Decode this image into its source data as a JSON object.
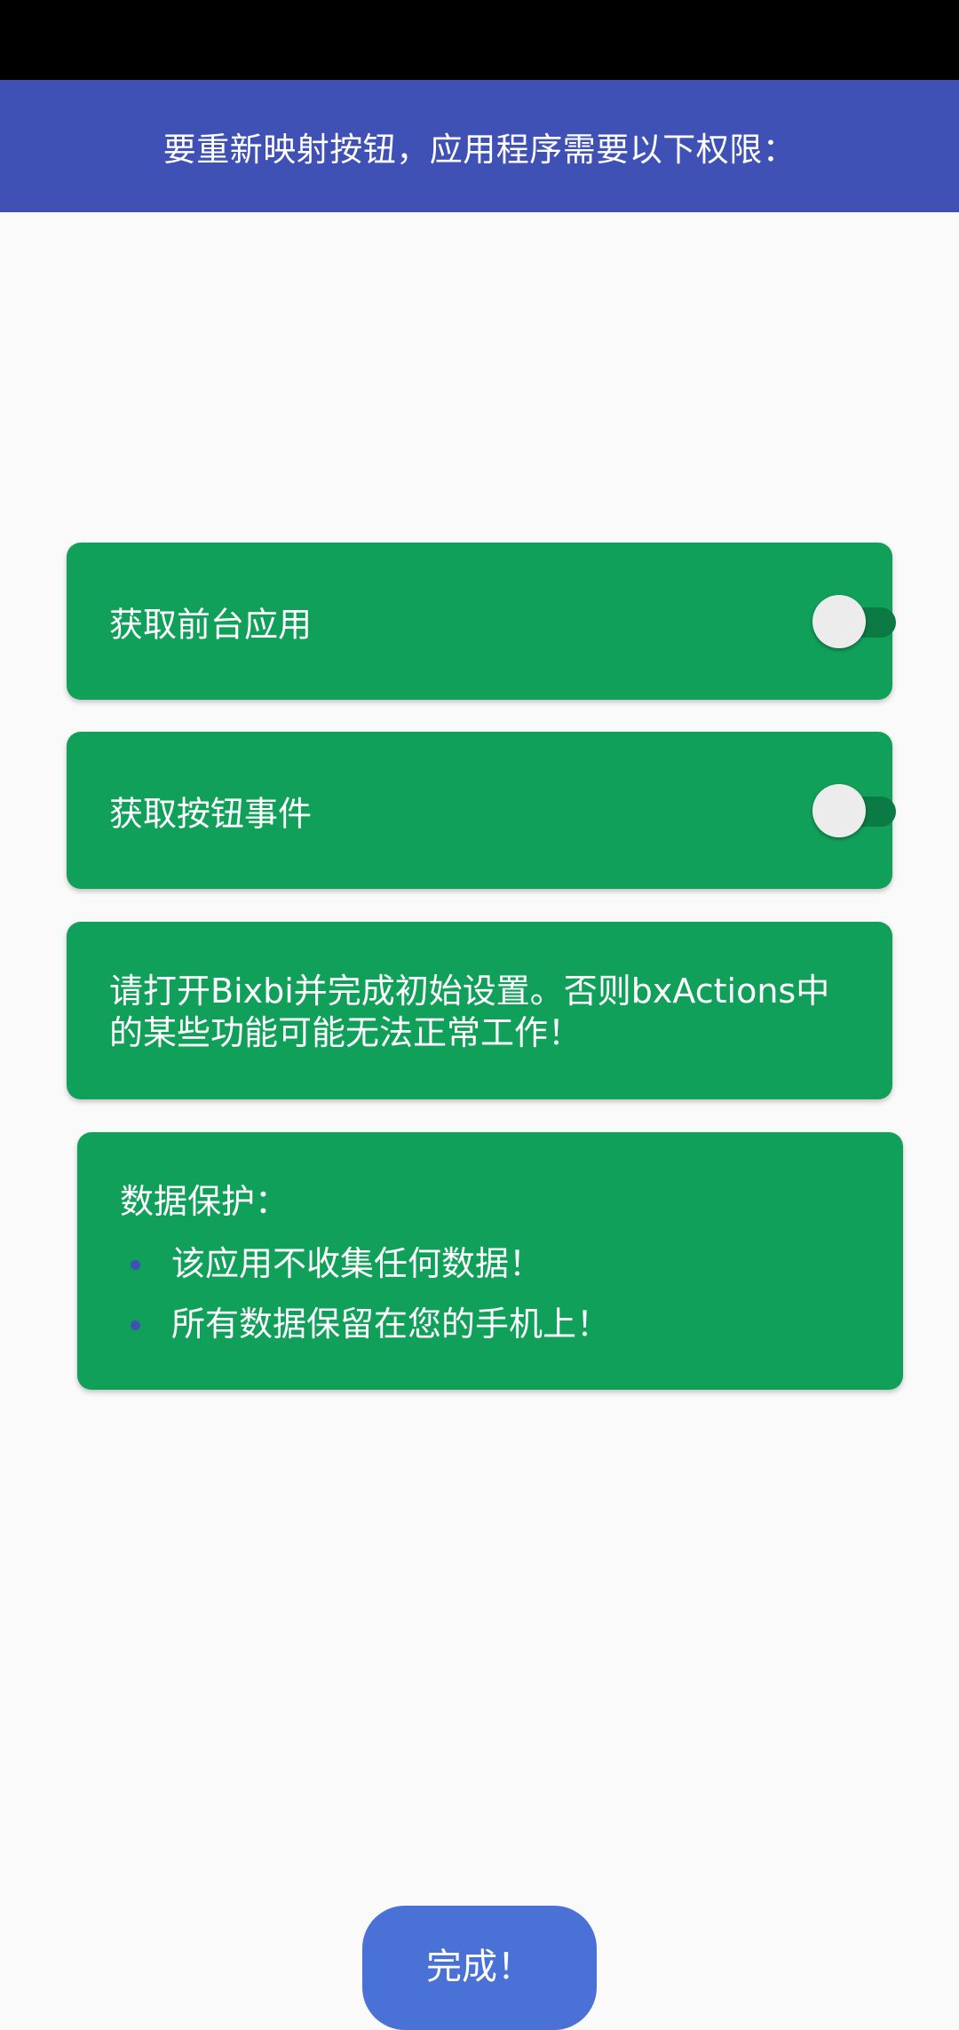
{
  "header": {
    "title": "要重新映射按钮，应用程序需要以下权限："
  },
  "permissions": [
    {
      "label": "获取前台应用",
      "enabled": false
    },
    {
      "label": "获取按钮事件",
      "enabled": false
    }
  ],
  "notice": {
    "text": "请打开Bixbi并完成初始设置。否则bxActions中的某些功能可能无法正常工作！"
  },
  "privacy": {
    "title": "数据保护：",
    "items": [
      "该应用不收集任何数据！",
      "所有数据保留在您的手机上！"
    ]
  },
  "footer": {
    "done_label": "完成！"
  },
  "colors": {
    "header_bg": "#3f51b5",
    "card_bg": "#11a05a",
    "button_bg": "#4a72d6",
    "page_bg": "#fafafa"
  }
}
